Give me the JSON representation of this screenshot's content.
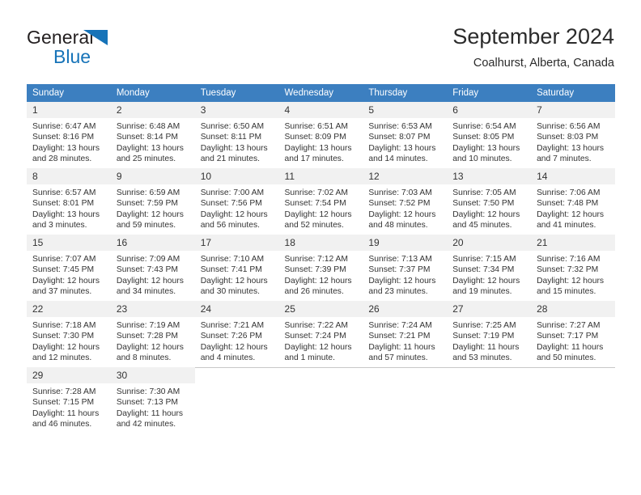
{
  "brand": {
    "name_dark": "General",
    "name_blue": "Blue",
    "accent_color": "#1673b8"
  },
  "header": {
    "title": "September 2024",
    "subtitle": "Coalhurst, Alberta, Canada"
  },
  "theme": {
    "header_row_bg": "#3c7fc0",
    "header_row_text": "#ffffff",
    "daynum_bg": "#f1f1f1",
    "grid_line": "#c8c8c8"
  },
  "calendar": {
    "weekday_headers": [
      "Sunday",
      "Monday",
      "Tuesday",
      "Wednesday",
      "Thursday",
      "Friday",
      "Saturday"
    ],
    "labels": {
      "sunrise_prefix": "Sunrise:",
      "sunset_prefix": "Sunset:",
      "daylight_prefix": "Daylight:"
    },
    "weeks": [
      [
        {
          "day": "1",
          "sunrise": "Sunrise: 6:47 AM",
          "sunset": "Sunset: 8:16 PM",
          "daylight": "Daylight: 13 hours and 28 minutes."
        },
        {
          "day": "2",
          "sunrise": "Sunrise: 6:48 AM",
          "sunset": "Sunset: 8:14 PM",
          "daylight": "Daylight: 13 hours and 25 minutes."
        },
        {
          "day": "3",
          "sunrise": "Sunrise: 6:50 AM",
          "sunset": "Sunset: 8:11 PM",
          "daylight": "Daylight: 13 hours and 21 minutes."
        },
        {
          "day": "4",
          "sunrise": "Sunrise: 6:51 AM",
          "sunset": "Sunset: 8:09 PM",
          "daylight": "Daylight: 13 hours and 17 minutes."
        },
        {
          "day": "5",
          "sunrise": "Sunrise: 6:53 AM",
          "sunset": "Sunset: 8:07 PM",
          "daylight": "Daylight: 13 hours and 14 minutes."
        },
        {
          "day": "6",
          "sunrise": "Sunrise: 6:54 AM",
          "sunset": "Sunset: 8:05 PM",
          "daylight": "Daylight: 13 hours and 10 minutes."
        },
        {
          "day": "7",
          "sunrise": "Sunrise: 6:56 AM",
          "sunset": "Sunset: 8:03 PM",
          "daylight": "Daylight: 13 hours and 7 minutes."
        }
      ],
      [
        {
          "day": "8",
          "sunrise": "Sunrise: 6:57 AM",
          "sunset": "Sunset: 8:01 PM",
          "daylight": "Daylight: 13 hours and 3 minutes."
        },
        {
          "day": "9",
          "sunrise": "Sunrise: 6:59 AM",
          "sunset": "Sunset: 7:59 PM",
          "daylight": "Daylight: 12 hours and 59 minutes."
        },
        {
          "day": "10",
          "sunrise": "Sunrise: 7:00 AM",
          "sunset": "Sunset: 7:56 PM",
          "daylight": "Daylight: 12 hours and 56 minutes."
        },
        {
          "day": "11",
          "sunrise": "Sunrise: 7:02 AM",
          "sunset": "Sunset: 7:54 PM",
          "daylight": "Daylight: 12 hours and 52 minutes."
        },
        {
          "day": "12",
          "sunrise": "Sunrise: 7:03 AM",
          "sunset": "Sunset: 7:52 PM",
          "daylight": "Daylight: 12 hours and 48 minutes."
        },
        {
          "day": "13",
          "sunrise": "Sunrise: 7:05 AM",
          "sunset": "Sunset: 7:50 PM",
          "daylight": "Daylight: 12 hours and 45 minutes."
        },
        {
          "day": "14",
          "sunrise": "Sunrise: 7:06 AM",
          "sunset": "Sunset: 7:48 PM",
          "daylight": "Daylight: 12 hours and 41 minutes."
        }
      ],
      [
        {
          "day": "15",
          "sunrise": "Sunrise: 7:07 AM",
          "sunset": "Sunset: 7:45 PM",
          "daylight": "Daylight: 12 hours and 37 minutes."
        },
        {
          "day": "16",
          "sunrise": "Sunrise: 7:09 AM",
          "sunset": "Sunset: 7:43 PM",
          "daylight": "Daylight: 12 hours and 34 minutes."
        },
        {
          "day": "17",
          "sunrise": "Sunrise: 7:10 AM",
          "sunset": "Sunset: 7:41 PM",
          "daylight": "Daylight: 12 hours and 30 minutes."
        },
        {
          "day": "18",
          "sunrise": "Sunrise: 7:12 AM",
          "sunset": "Sunset: 7:39 PM",
          "daylight": "Daylight: 12 hours and 26 minutes."
        },
        {
          "day": "19",
          "sunrise": "Sunrise: 7:13 AM",
          "sunset": "Sunset: 7:37 PM",
          "daylight": "Daylight: 12 hours and 23 minutes."
        },
        {
          "day": "20",
          "sunrise": "Sunrise: 7:15 AM",
          "sunset": "Sunset: 7:34 PM",
          "daylight": "Daylight: 12 hours and 19 minutes."
        },
        {
          "day": "21",
          "sunrise": "Sunrise: 7:16 AM",
          "sunset": "Sunset: 7:32 PM",
          "daylight": "Daylight: 12 hours and 15 minutes."
        }
      ],
      [
        {
          "day": "22",
          "sunrise": "Sunrise: 7:18 AM",
          "sunset": "Sunset: 7:30 PM",
          "daylight": "Daylight: 12 hours and 12 minutes."
        },
        {
          "day": "23",
          "sunrise": "Sunrise: 7:19 AM",
          "sunset": "Sunset: 7:28 PM",
          "daylight": "Daylight: 12 hours and 8 minutes."
        },
        {
          "day": "24",
          "sunrise": "Sunrise: 7:21 AM",
          "sunset": "Sunset: 7:26 PM",
          "daylight": "Daylight: 12 hours and 4 minutes."
        },
        {
          "day": "25",
          "sunrise": "Sunrise: 7:22 AM",
          "sunset": "Sunset: 7:24 PM",
          "daylight": "Daylight: 12 hours and 1 minute."
        },
        {
          "day": "26",
          "sunrise": "Sunrise: 7:24 AM",
          "sunset": "Sunset: 7:21 PM",
          "daylight": "Daylight: 11 hours and 57 minutes."
        },
        {
          "day": "27",
          "sunrise": "Sunrise: 7:25 AM",
          "sunset": "Sunset: 7:19 PM",
          "daylight": "Daylight: 11 hours and 53 minutes."
        },
        {
          "day": "28",
          "sunrise": "Sunrise: 7:27 AM",
          "sunset": "Sunset: 7:17 PM",
          "daylight": "Daylight: 11 hours and 50 minutes."
        }
      ],
      [
        {
          "day": "29",
          "sunrise": "Sunrise: 7:28 AM",
          "sunset": "Sunset: 7:15 PM",
          "daylight": "Daylight: 11 hours and 46 minutes."
        },
        {
          "day": "30",
          "sunrise": "Sunrise: 7:30 AM",
          "sunset": "Sunset: 7:13 PM",
          "daylight": "Daylight: 11 hours and 42 minutes."
        },
        {
          "day": "",
          "sunrise": "",
          "sunset": "",
          "daylight": ""
        },
        {
          "day": "",
          "sunrise": "",
          "sunset": "",
          "daylight": ""
        },
        {
          "day": "",
          "sunrise": "",
          "sunset": "",
          "daylight": ""
        },
        {
          "day": "",
          "sunrise": "",
          "sunset": "",
          "daylight": ""
        },
        {
          "day": "",
          "sunrise": "",
          "sunset": "",
          "daylight": ""
        }
      ]
    ]
  }
}
